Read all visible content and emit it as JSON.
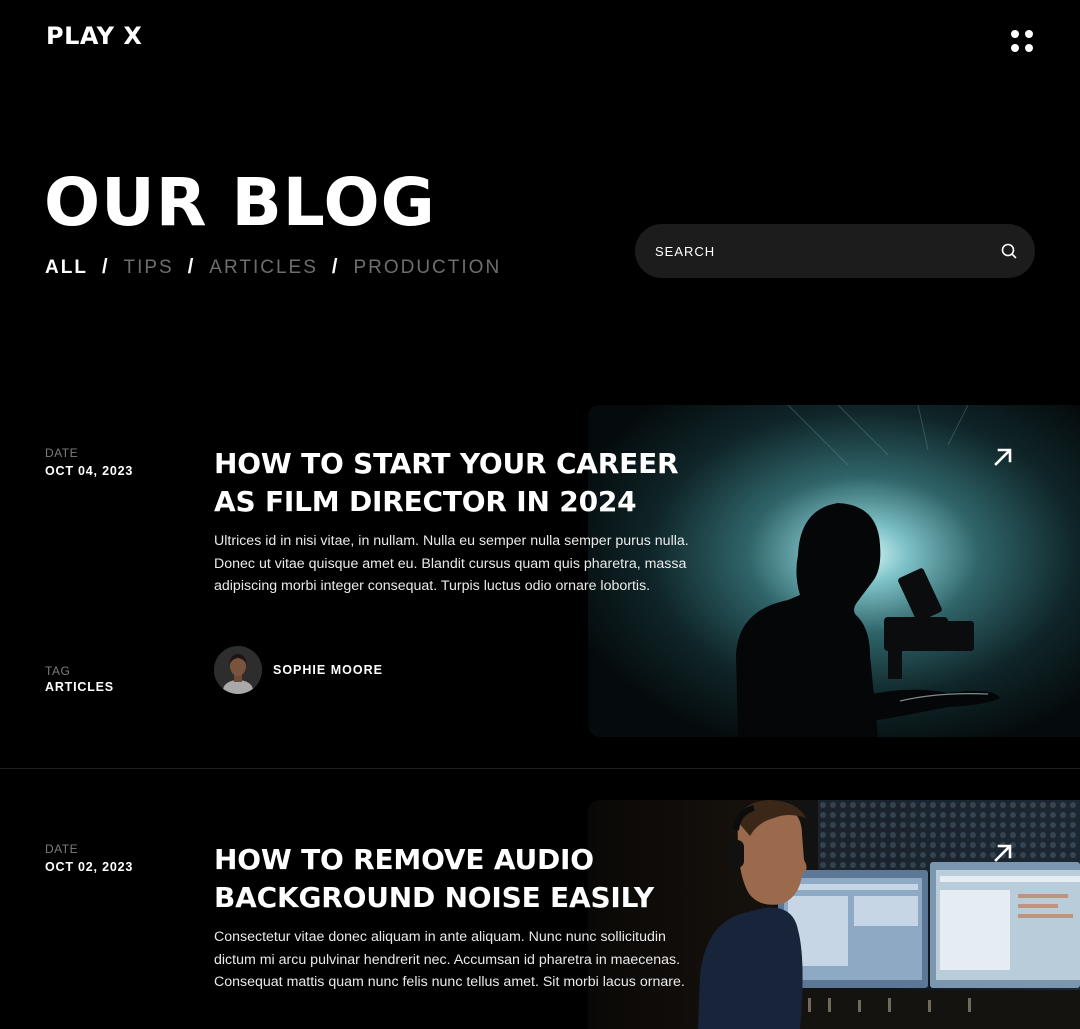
{
  "header": {
    "logo": "PLAY X",
    "menu_icon": "grid-dots-icon"
  },
  "hero": {
    "title": "OUR BLOG",
    "filters": [
      {
        "label": "ALL",
        "active": true
      },
      {
        "label": "TIPS",
        "active": false
      },
      {
        "label": "ARTICLES",
        "active": false
      },
      {
        "label": "PRODUCTION",
        "active": false
      }
    ],
    "separator": "/"
  },
  "search": {
    "placeholder": "SEARCH",
    "icon": "search-icon"
  },
  "posts": [
    {
      "date_label": "DATE",
      "date": "OCT 04, 2023",
      "title": "HOW TO START YOUR CAREER AS FILM DIRECTOR IN 2024",
      "excerpt": "Ultrices id in nisi vitae, in nullam. Nulla eu semper nulla semper purus nulla. Donec ut vitae quisque amet eu. Blandit cursus quam quis pharetra, massa adipiscing morbi integer consequat. Turpis luctus odio ornare lobortis.",
      "tag_label": "TAG",
      "tag": "ARTICLES",
      "author": "SOPHIE MOORE",
      "image": "film-director-silhouette",
      "arrow_icon": "arrow-up-right-icon"
    },
    {
      "date_label": "DATE",
      "date": "OCT 02, 2023",
      "title": "HOW TO REMOVE AUDIO BACKGROUND NOISE EASILY",
      "excerpt": "Consectetur vitae donec aliquam in ante aliquam. Nunc nunc sollicitudin dictum mi arcu pulvinar hendrerit nec. Accumsan id pharetra in maecenas. Consequat mattis quam nunc felis nunc tellus amet. Sit morbi lacus ornare.",
      "image": "audio-engineer-studio",
      "arrow_icon": "arrow-up-right-icon"
    }
  ],
  "colors": {
    "background": "#000000",
    "text": "#ffffff",
    "muted": "#6e6e6e",
    "search_bg": "#1c1c1c"
  }
}
